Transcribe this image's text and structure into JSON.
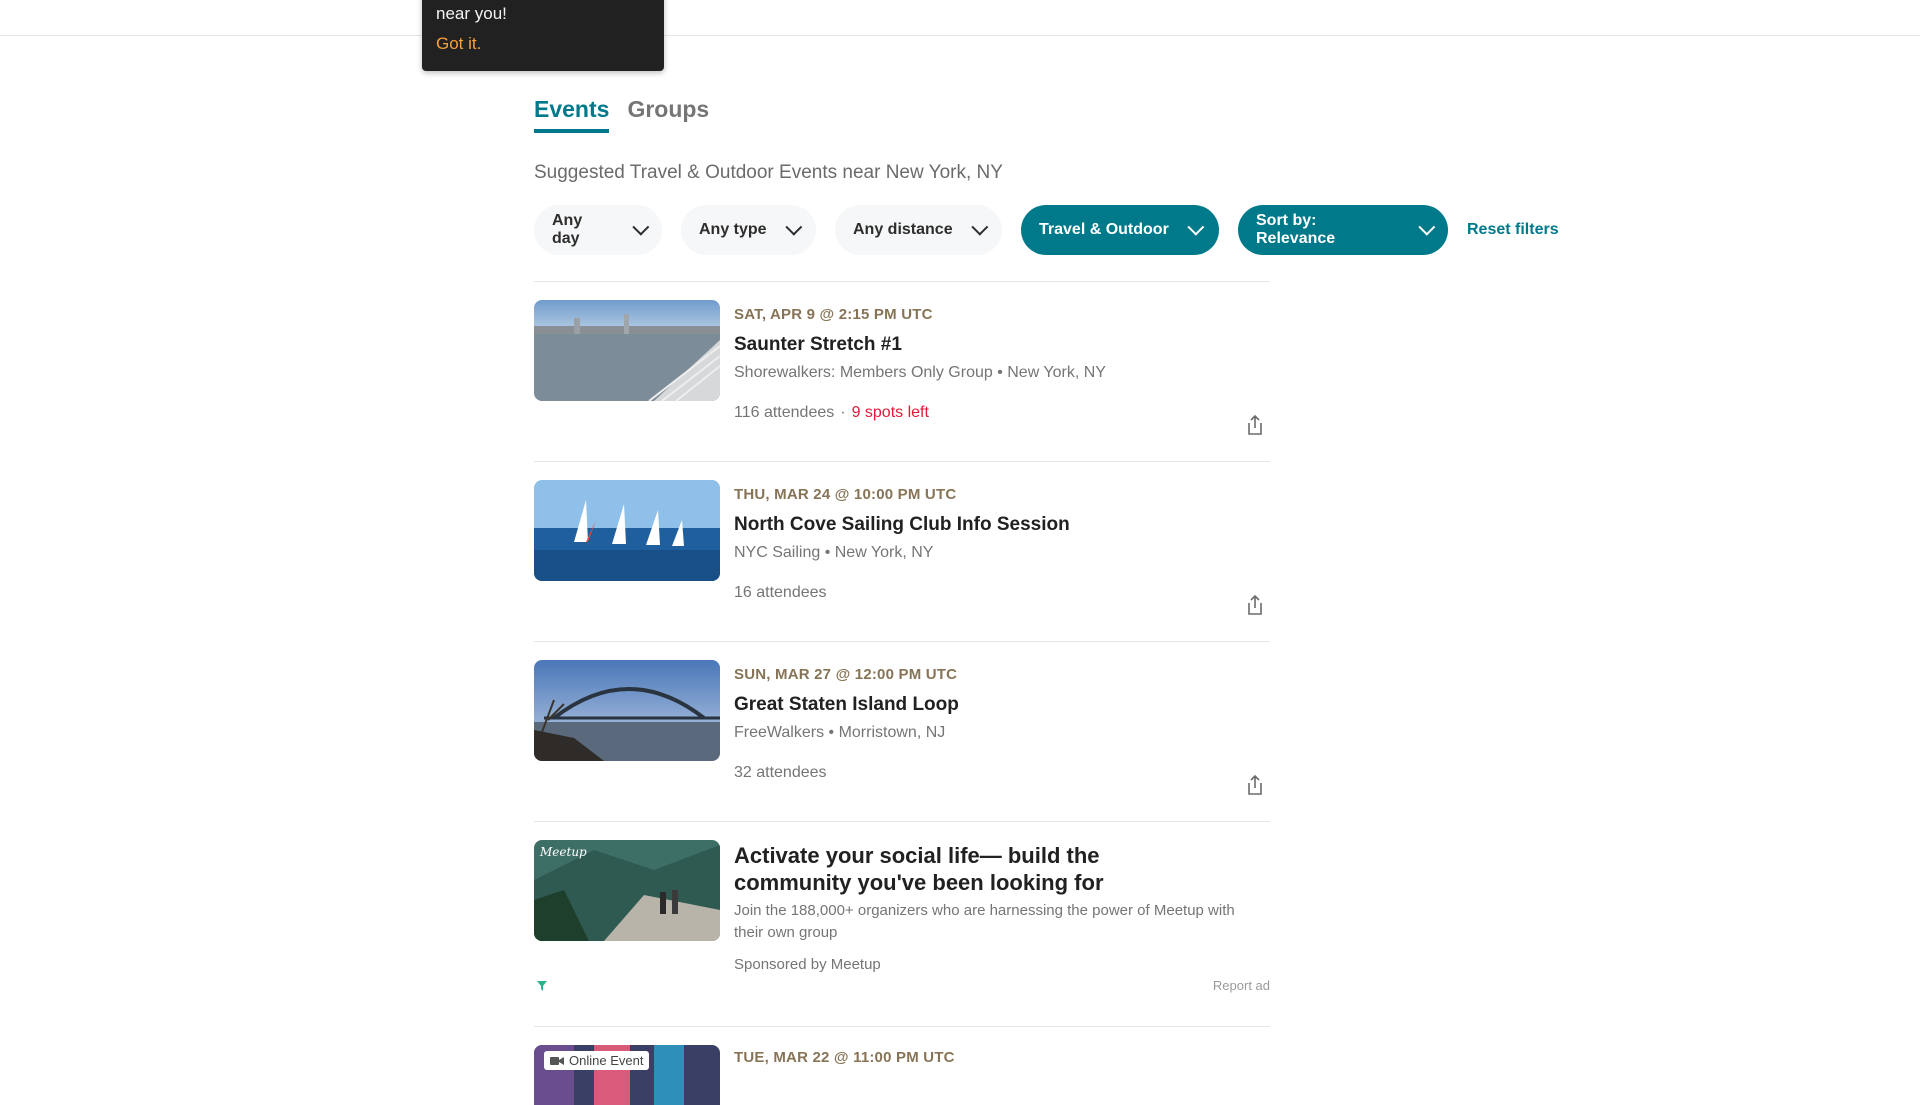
{
  "tooltip": {
    "text": "near you!",
    "link": "Got it."
  },
  "tabs": [
    {
      "label": "Events",
      "active": true
    },
    {
      "label": "Groups",
      "active": false
    }
  ],
  "subtitle": "Suggested Travel & Outdoor Events near New York, NY",
  "filters": {
    "day": "Any day",
    "type": "Any type",
    "distance": "Any distance",
    "category": "Travel & Outdoor",
    "sort": "Sort by: Relevance",
    "reset": "Reset filters"
  },
  "events": [
    {
      "date": "SAT, APR 9 @ 2:15 PM UTC",
      "title": "Saunter Stretch #1",
      "group": "Shorewalkers: Members Only Group • New York, NY",
      "attendees": "116 attendees",
      "spots": "9 spots left"
    },
    {
      "date": "THU, MAR 24 @ 10:00 PM UTC",
      "title": "North Cove Sailing Club Info Session",
      "group": "NYC Sailing • New York, NY",
      "attendees": "16 attendees"
    },
    {
      "date": "SUN, MAR 27 @ 12:00 PM UTC",
      "title": "Great Staten Island Loop",
      "group": "FreeWalkers • Morristown, NJ",
      "attendees": "32 attendees"
    }
  ],
  "ad": {
    "title": "Activate your social life— build the community you've been looking for",
    "description": "Join the 188,000+ organizers who are harnessing the power of Meetup with their own group",
    "sponsor": "Sponsored by Meetup",
    "report": "Report ad",
    "logo_text": "Meetup"
  },
  "next_event": {
    "date": "TUE, MAR 22 @ 11:00 PM UTC",
    "badge": "Online Event"
  },
  "colors": {
    "accent": "#00798a",
    "date": "#877457",
    "alert": "#e51937",
    "tooltip_link": "#f6a13c"
  }
}
